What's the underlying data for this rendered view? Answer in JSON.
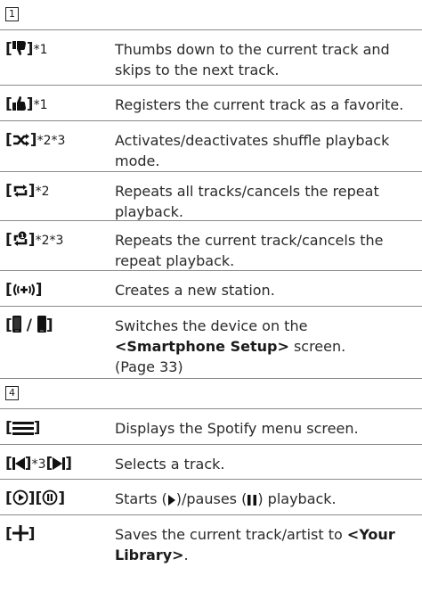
{
  "sections": [
    {
      "number": "1",
      "rows": [
        {
          "keys": {
            "k1_sup": "*1"
          },
          "description": "Thumbs down to the current track and skips to the next track.",
          "icon": "thumbs-down-icon"
        },
        {
          "keys": {
            "k1_sup": "*1"
          },
          "description": "Registers the current track as a favorite.",
          "icon": "thumbs-up-icon"
        },
        {
          "keys": {
            "k1_sup": "*2*3"
          },
          "description": "Activates/deactivates shuffle playback mode.",
          "icon": "shuffle-icon"
        },
        {
          "keys": {
            "k1_sup": "*2"
          },
          "description": "Repeats all tracks/cancels the repeat playback.",
          "icon": "repeat-icon"
        },
        {
          "keys": {
            "k1_sup": "*2*3"
          },
          "description": "Repeats the current track/cancels the repeat playback.",
          "icon": "repeat-one-icon"
        },
        {
          "keys": {},
          "description": "Creates a new station.",
          "icon": "new-station-icon"
        },
        {
          "keys": {
            "slash": "/"
          },
          "description_parts": {
            "pre": "Switches the device on the ",
            "bold": "<Smartphone Setup>",
            "post": " screen.",
            "page_ref": "(Page 33)"
          },
          "icon": "smartphone-icon"
        }
      ]
    },
    {
      "number": "4",
      "rows": [
        {
          "keys": {},
          "description": "Displays the Spotify menu screen.",
          "icon": "menu-icon"
        },
        {
          "keys": {
            "k1_sup": "*3"
          },
          "description": "Selects a track.",
          "icon": "skip-icons"
        },
        {
          "keys": {},
          "description_parts": {
            "pre": "Starts (",
            "mid": ")/pauses (",
            "post": ") playback."
          },
          "icon": "play-pause-icons"
        },
        {
          "keys": {},
          "description_parts": {
            "pre": "Saves the current track/artist to ",
            "bold": "<Your Library>",
            "post": "."
          },
          "icon": "plus-icon"
        }
      ]
    }
  ]
}
